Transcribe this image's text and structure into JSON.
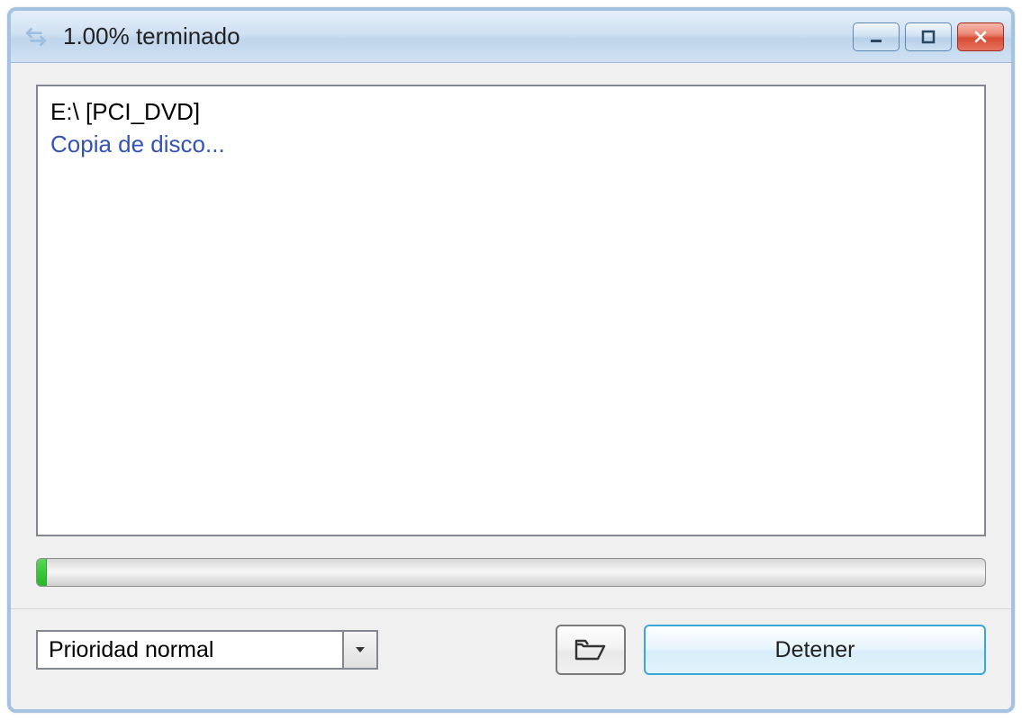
{
  "window": {
    "title": "1.00% terminado"
  },
  "log": {
    "path": "E:\\ [PCI_DVD]",
    "status": "Copia de disco..."
  },
  "progress": {
    "percent": 1.0
  },
  "priority": {
    "selected": "Prioridad normal"
  },
  "buttons": {
    "stop": "Detener"
  },
  "icons": {
    "app": "arrows-exchange",
    "minimize": "minimize",
    "maximize": "maximize",
    "close": "close",
    "open_folder": "open-folder",
    "dropdown": "chevron-down"
  }
}
